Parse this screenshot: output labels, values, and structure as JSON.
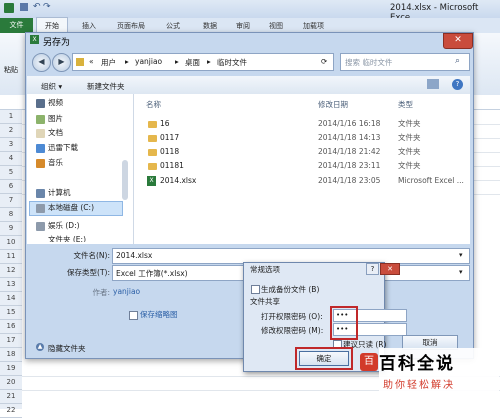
{
  "excel": {
    "window_title": "2014.xlsx - Microsoft Exce",
    "tabs": [
      "文件",
      "开始",
      "插入",
      "页面布局",
      "公式",
      "数据",
      "审阅",
      "视图",
      "加载项"
    ],
    "left_fragment": "粘贴",
    "row_numbers": [
      "1",
      "2",
      "3",
      "4",
      "5",
      "6",
      "7",
      "8",
      "9",
      "10",
      "11",
      "12",
      "13",
      "14",
      "15",
      "16",
      "17",
      "18",
      "19",
      "20",
      "21",
      "22"
    ]
  },
  "save_dialog": {
    "title": "另存为",
    "address": {
      "prefix": "«",
      "parts": [
        "用户",
        "yanjiao",
        "桌面",
        "临时文件"
      ]
    },
    "search_placeholder": "搜索 临时文件",
    "toolbar": {
      "organize": "组织 ▾",
      "new_folder": "新建文件夹"
    },
    "nav_items": [
      "视频",
      "图片",
      "文档",
      "迅雷下载",
      "音乐",
      "计算机",
      "本地磁盘 (C:)",
      "娱乐 (D:)",
      "文件夹 (E:)"
    ],
    "columns": {
      "name": "名称",
      "date": "修改日期",
      "type": "类型"
    },
    "files": [
      {
        "name": "16",
        "date": "2014/1/16 16:18",
        "type": "文件夹"
      },
      {
        "name": "0117",
        "date": "2014/1/18 14:13",
        "type": "文件夹"
      },
      {
        "name": "0118",
        "date": "2014/1/18 21:42",
        "type": "文件夹"
      },
      {
        "name": "01181",
        "date": "2014/1/18 23:11",
        "type": "文件夹"
      },
      {
        "name": "2014.xlsx",
        "date": "2014/1/18 23:05",
        "type": "Microsoft Excel ..."
      }
    ],
    "filename_label": "文件名(N):",
    "filename_value": "2014.xlsx",
    "savetype_label": "保存类型(T):",
    "savetype_value": "Excel 工作簿(*.xlsx)",
    "author_label": "作者:",
    "author_value": "yanjiao",
    "thumbnail_label": "保存缩略图",
    "hide_folders": "隐藏文件夹",
    "close_glyph": "✕"
  },
  "options_dialog": {
    "title": "常规选项",
    "help": "?",
    "close": "✕",
    "backup_label": "生成备份文件 (B)",
    "share_label": "文件共享",
    "open_pw_label": "打开权限密码 (O):",
    "open_pw_value": "•••",
    "modify_pw_label": "修改权限密码 (M):",
    "modify_pw_value": "•••",
    "readonly_label": "建议只读 (R)",
    "ok": "确定",
    "cancel": "取消"
  },
  "watermark": {
    "main": "百科全说",
    "sub": "助你轻松解决",
    "logo_glyph": "百"
  }
}
